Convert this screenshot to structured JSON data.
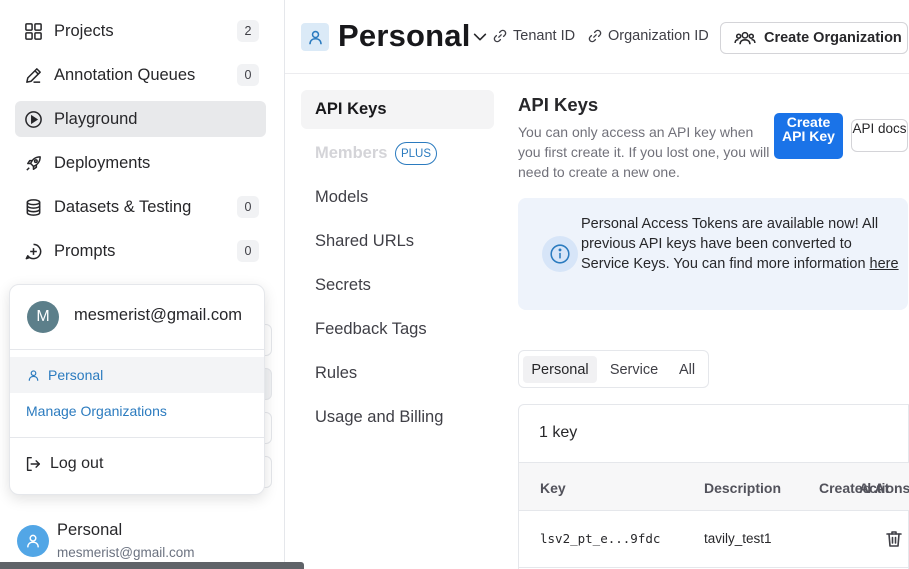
{
  "sidebar": {
    "items": [
      {
        "label": "Projects",
        "count": "2",
        "icon": "grid-icon"
      },
      {
        "label": "Annotation Queues",
        "count": "0",
        "icon": "pen-icon"
      },
      {
        "label": "Playground",
        "count": null,
        "icon": "play-circle-icon",
        "active": true
      },
      {
        "label": "Deployments",
        "count": null,
        "icon": "rocket-icon"
      },
      {
        "label": "Datasets & Testing",
        "count": "0",
        "icon": "database-icon"
      },
      {
        "label": "Prompts",
        "count": "0",
        "icon": "prompt-plus-icon"
      }
    ],
    "user": {
      "name": "Personal",
      "email": "mesmerist@gmail.com",
      "icon": "user-icon"
    }
  },
  "dropdown": {
    "avatar_initial": "M",
    "email": "mesmerist@gmail.com",
    "personal_label": "Personal",
    "manage_label": "Manage Organizations",
    "logout_label": "Log out"
  },
  "header": {
    "title": "Personal",
    "tenant_id_label": "Tenant ID",
    "organization_id_label": "Organization ID",
    "create_org_label": "Create Organization"
  },
  "settings_nav": {
    "items": [
      {
        "label": "API Keys",
        "state": "active"
      },
      {
        "label": "Members",
        "state": "disabled",
        "badge": "PLUS"
      },
      {
        "label": "Models"
      },
      {
        "label": "Shared URLs"
      },
      {
        "label": "Secrets"
      },
      {
        "label": "Feedback Tags"
      },
      {
        "label": "Rules"
      },
      {
        "label": "Usage and Billing"
      }
    ]
  },
  "api_keys": {
    "title": "API Keys",
    "description": "You can only access an API key when you first create it. If you lost one, you will need to create a new one.",
    "create_button": "Create API Key",
    "docs_button": "API docs",
    "notice_text": "Personal Access Tokens are available now! All previous API keys have been converted to Service Keys. You can find more information ",
    "notice_link": "here",
    "filters": [
      "Personal",
      "Service",
      "All"
    ],
    "active_filter": "Personal",
    "key_count": "1 key",
    "columns": {
      "key": "Key",
      "description": "Description",
      "created_at": "Created At",
      "actions": "Actions"
    },
    "rows": [
      {
        "key": "lsv2_pt_e...9fdc",
        "description": "tavily_test1"
      }
    ]
  },
  "colors": {
    "accent": "#1a73e8",
    "link": "#2b7bbf",
    "active_bg": "#e8e9eb",
    "notice_bg": "#eef3fb"
  }
}
